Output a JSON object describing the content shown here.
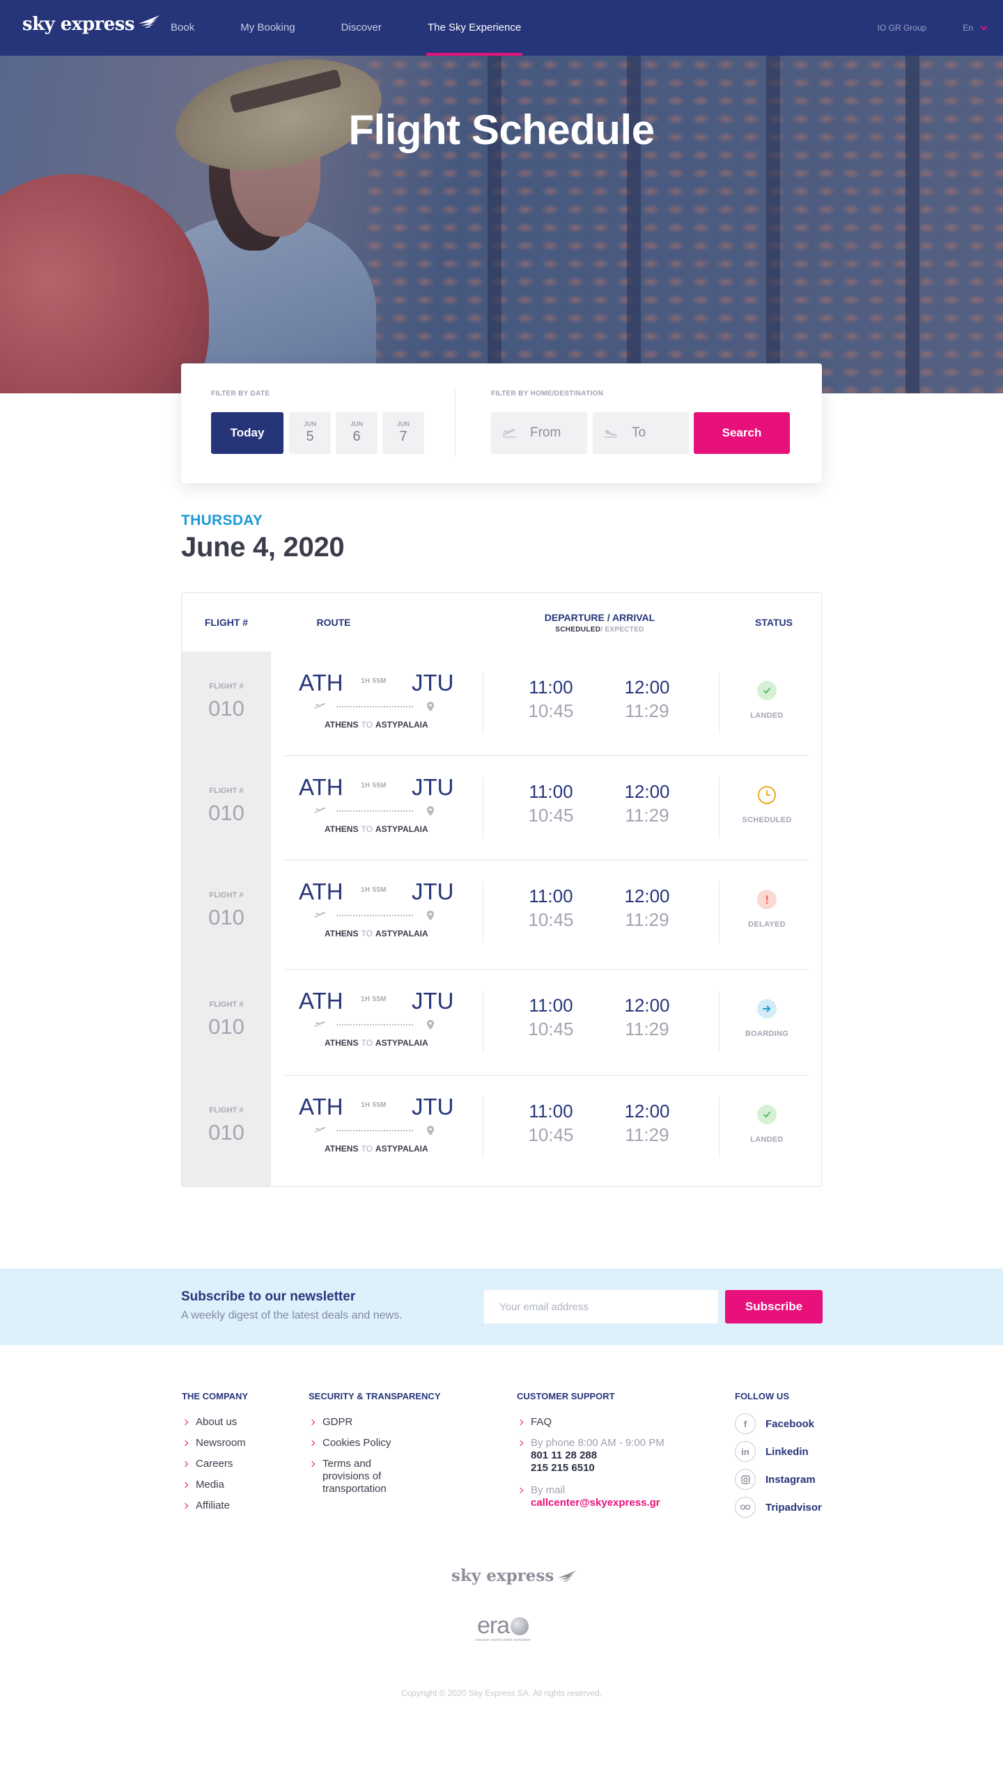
{
  "nav": {
    "logo_text": "sky express",
    "links": [
      {
        "label": "Book"
      },
      {
        "label": "My Booking"
      },
      {
        "label": "Discover"
      },
      {
        "label": "The Sky Experience",
        "active": true
      }
    ],
    "group_label": "IO GR Group",
    "language": "En"
  },
  "hero": {
    "title": "Flight Schedule"
  },
  "filter": {
    "date_label": "FILTER BY DATE",
    "today_label": "Today",
    "dates": [
      {
        "month": "JUN",
        "day": "5"
      },
      {
        "month": "JUN",
        "day": "6"
      },
      {
        "month": "JUN",
        "day": "7"
      }
    ],
    "dest_label": "FILTER BY HOME/DESTINATION",
    "from_label": "From",
    "to_label": "To",
    "search_label": "Search"
  },
  "schedule": {
    "weekday": "THURSDAY",
    "date": "June 4, 2020"
  },
  "table": {
    "headers": {
      "flight": "FLIGHT #",
      "route": "ROUTE",
      "dep_arr": "DEPARTURE / ARRIVAL",
      "sub_scheduled": "SCHEDULED",
      "sub_expected": "/ EXPECTED",
      "status": "STATUS"
    },
    "rows": [
      {
        "flight_label": "FLIGHT #",
        "flight_no": "010",
        "from": "ATH",
        "to": "JTU",
        "duration": "1H 55M",
        "from_city": "ATHENS",
        "to_word": "TO",
        "to_city": "ASTYPALAIA",
        "dep_sched": "11:00",
        "dep_exp": "10:45",
        "arr_sched": "12:00",
        "arr_exp": "11:29",
        "status": "LANDED",
        "status_icon": "check-icon"
      },
      {
        "flight_label": "FLIGHT #",
        "flight_no": "010",
        "from": "ATH",
        "to": "JTU",
        "duration": "1H 55M",
        "from_city": "ATHENS",
        "to_word": "TO",
        "to_city": "ASTYPALAIA",
        "dep_sched": "11:00",
        "dep_exp": "10:45",
        "arr_sched": "12:00",
        "arr_exp": "11:29",
        "status": "SCHEDULED",
        "status_icon": "clock-icon"
      },
      {
        "flight_label": "FLIGHT #",
        "flight_no": "010",
        "from": "ATH",
        "to": "JTU",
        "duration": "1H 55M",
        "from_city": "ATHENS",
        "to_word": "TO",
        "to_city": "ASTYPALAIA",
        "dep_sched": "11:00",
        "dep_exp": "10:45",
        "arr_sched": "12:00",
        "arr_exp": "11:29",
        "status": "DELAYED",
        "status_icon": "exclamation-icon"
      },
      {
        "flight_label": "FLIGHT #",
        "flight_no": "010",
        "from": "ATH",
        "to": "JTU",
        "duration": "1H 55M",
        "from_city": "ATHENS",
        "to_word": "TO",
        "to_city": "ASTYPALAIA",
        "dep_sched": "11:00",
        "dep_exp": "10:45",
        "arr_sched": "12:00",
        "arr_exp": "11:29",
        "status": "BOARDING",
        "status_icon": "arrow-right-icon"
      },
      {
        "flight_label": "FLIGHT #",
        "flight_no": "010",
        "from": "ATH",
        "to": "JTU",
        "duration": "1H 55M",
        "from_city": "ATHENS",
        "to_word": "TO",
        "to_city": "ASTYPALAIA",
        "dep_sched": "11:00",
        "dep_exp": "10:45",
        "arr_sched": "12:00",
        "arr_exp": "11:29",
        "status": "LANDED",
        "status_icon": "check-icon"
      }
    ]
  },
  "newsletter": {
    "title": "Subscribe to our newsletter",
    "subtitle": "A weekly digest of the latest deals and news.",
    "placeholder": "Your email address",
    "button": "Subscribe"
  },
  "footer": {
    "company": {
      "title": "THE COMPANY",
      "links": [
        "About us",
        "Newsroom",
        "Careers",
        "Media",
        "Affiliate"
      ]
    },
    "security": {
      "title": "SECURITY & TRANSPARENCY",
      "links": [
        "GDPR",
        "Cookies Policy",
        "Terms and provisions of transportation"
      ]
    },
    "support": {
      "title": "CUSTOMER SUPPORT",
      "faq": "FAQ",
      "phone_label": "By phone 8:00 AM - 9:00 PM",
      "phone_1": "801 11 28 288",
      "phone_2": "215 215 6510",
      "mail_label": "By mail",
      "email": "callcenter@skyexpress.gr"
    },
    "follow": {
      "title": "FOLLOW US",
      "items": [
        {
          "name": "Facebook",
          "icon": "facebook-icon"
        },
        {
          "name": "Linkedin",
          "icon": "linkedin-icon"
        },
        {
          "name": "Instagram",
          "icon": "instagram-icon"
        },
        {
          "name": "Tripadvisor",
          "icon": "tripadvisor-icon"
        }
      ]
    },
    "logo_text": "sky express",
    "era_text": "era",
    "era_tagline": "european regions airline association",
    "copyright": "Copyright © 2020 Sky Express SA. All rights reserved."
  },
  "colors": {
    "navy": "#26357a",
    "pink": "#e8107a",
    "cyan": "#1a9ad6",
    "landed": "#5bb85d",
    "scheduled": "#f0a81f",
    "delayed": "#ee6a5a",
    "boarding": "#1a9ad6"
  }
}
